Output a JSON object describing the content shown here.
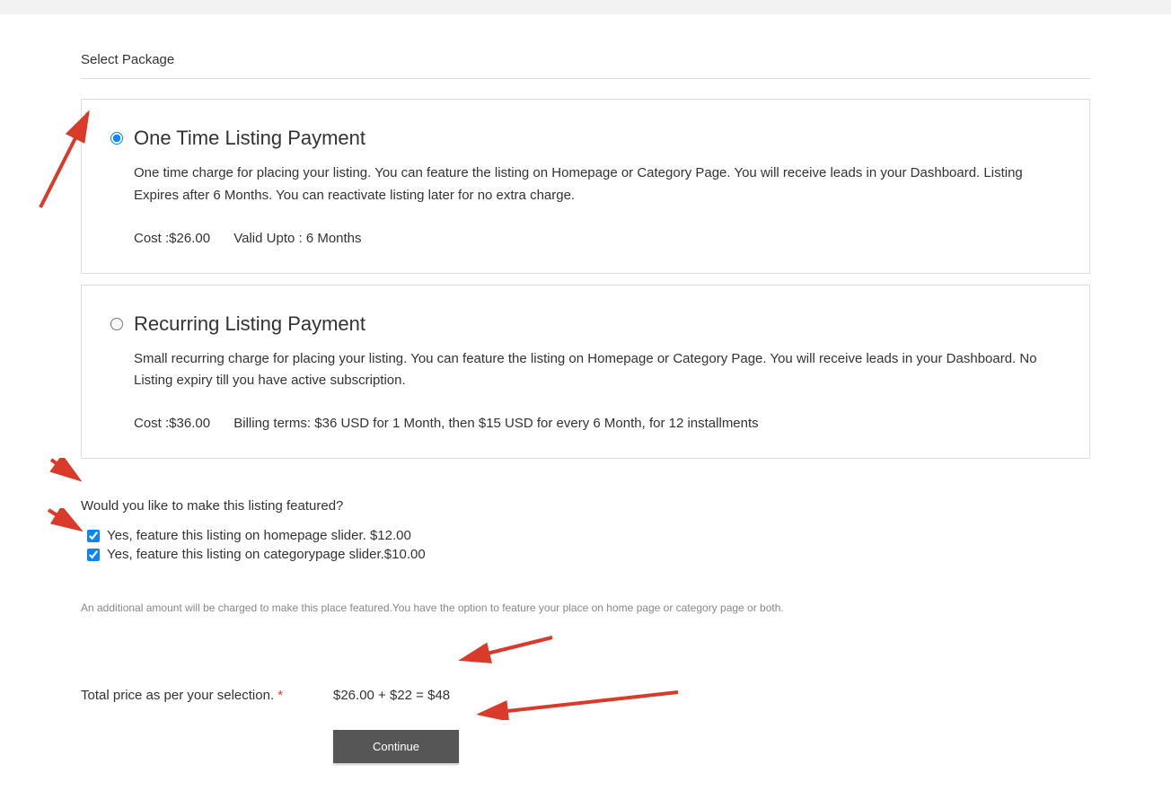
{
  "section": {
    "title": "Select Package"
  },
  "packages": [
    {
      "title": "One Time Listing Payment",
      "description": "One time charge for placing your listing. You can feature the listing on Homepage or Category Page. You will receive leads in your Dashboard. Listing Expires after 6 Months. You can reactivate listing later for no extra charge.",
      "cost": "Cost :$26.00",
      "billing": "Valid Upto : 6 Months",
      "selected": true
    },
    {
      "title": "Recurring Listing Payment",
      "description": "Small recurring charge for placing your listing. You can feature the listing on Homepage or Category Page. You will receive leads in your Dashboard. No Listing expiry till you have active subscription.",
      "cost": "Cost :$36.00",
      "billing": "Billing terms: $36 USD for 1 Month, then $15 USD for every 6 Month, for 12 installments",
      "selected": false
    }
  ],
  "featured": {
    "question": "Would you like to make this listing featured?",
    "options": [
      {
        "label": "Yes, feature this listing on homepage slider. $12.00",
        "checked": true
      },
      {
        "label": "Yes, feature this listing on categorypage slider.$10.00",
        "checked": true
      }
    ],
    "note": "An additional amount will be charged to make this place featured.You have the option to feature your place on home page or category page or both."
  },
  "total": {
    "label": "Total price as per your selection. ",
    "required_marker": "*",
    "value": "$26.00 + $22 = $48"
  },
  "buttons": {
    "continue": "Continue"
  }
}
